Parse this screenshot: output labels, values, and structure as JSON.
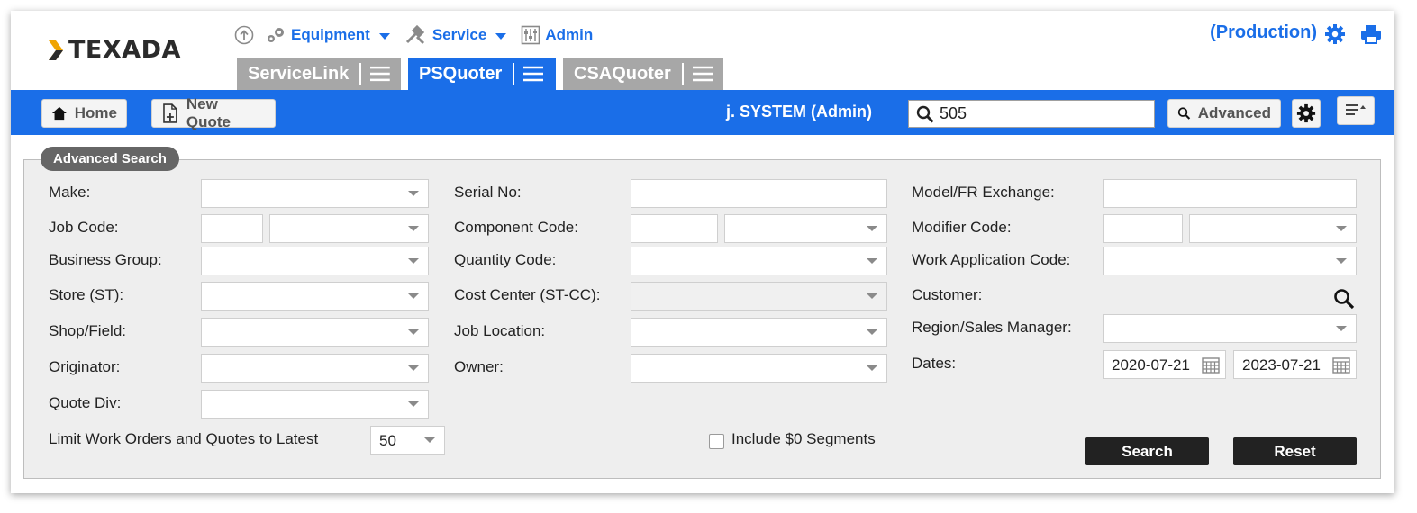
{
  "brand": {
    "name": "TEXADA"
  },
  "nav": {
    "equipment_label": "Equipment",
    "service_label": "Service",
    "admin_label": "Admin"
  },
  "environment": "(Production)",
  "tabs": [
    {
      "label": "ServiceLink"
    },
    {
      "label": "PSQuoter"
    },
    {
      "label": "CSAQuoter"
    }
  ],
  "toolbar": {
    "home_label": "Home",
    "new_quote_label": "New Quote",
    "user_label": "j. SYSTEM (Admin)",
    "search_value": "505",
    "advanced_label": "Advanced"
  },
  "panel": {
    "title": "Advanced Search",
    "labels": {
      "make": "Make:",
      "job_code": "Job Code:",
      "business_group": "Business Group:",
      "store": "Store (ST):",
      "shop_field": "Shop/Field:",
      "originator": "Originator:",
      "quote_div": "Quote Div:",
      "limit": "Limit Work Orders and Quotes to Latest",
      "serial_no": "Serial No:",
      "component_code": "Component Code:",
      "quantity_code": "Quantity Code:",
      "cost_center": "Cost Center (ST-CC):",
      "job_location": "Job Location:",
      "owner": "Owner:",
      "model_fr": "Model/FR Exchange:",
      "modifier_code": "Modifier Code:",
      "work_app_code": "Work Application Code:",
      "customer": "Customer:",
      "region_sales": "Region/Sales Manager:",
      "dates": "Dates:"
    },
    "limit_value": "50",
    "include_zero_label": "Include $0 Segments",
    "date_from": "2020-07-21",
    "date_to": "2023-07-21",
    "search_label": "Search",
    "reset_label": "Reset"
  },
  "colors": {
    "accent": "#1a6ee8",
    "tab_inactive": "#a7a7a7",
    "panel_bg": "#eeeeee",
    "dark_button": "#222222"
  }
}
